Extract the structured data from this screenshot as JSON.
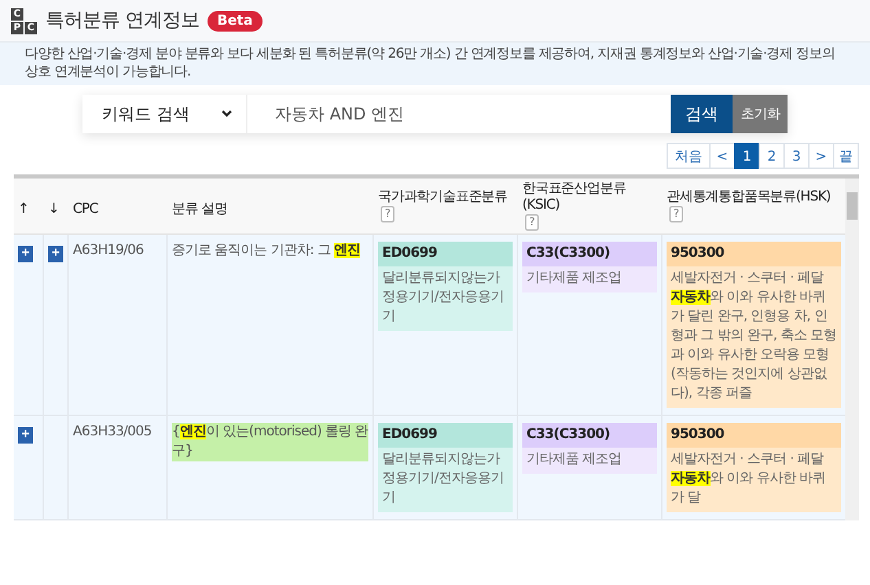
{
  "header": {
    "logo_letters": [
      "C",
      "P",
      "C"
    ],
    "title": "특허분류 연계정보",
    "badge": "Beta"
  },
  "notice": "다양한 산업·기술·경제 분야 분류와 보다 세분화 된 특허분류(약 26만 개소) 간 연계정보를 제공하여, 지재권 통계정보와 산업·기술·경제 정보의 상호 연계분석이 가능합니다.",
  "search": {
    "mode": "키워드 검색",
    "query": "자동차 AND 엔진",
    "buttons": [
      "검색",
      "초기화"
    ]
  },
  "pagination": [
    {
      "label": "처음",
      "selected": false
    },
    {
      "label": "<",
      "selected": false
    },
    {
      "label": "1",
      "selected": true
    },
    {
      "label": "2",
      "selected": false
    },
    {
      "label": "3",
      "selected": false
    },
    {
      "label": ">",
      "selected": false
    },
    {
      "label": "끝",
      "selected": false
    }
  ],
  "table": {
    "columns": [
      {
        "label": "↑"
      },
      {
        "label": "↓"
      },
      {
        "label": "CPC"
      },
      {
        "label": "분류 설명"
      },
      {
        "label": "국가과학기술표준분류",
        "help": "?"
      },
      {
        "label": "한국표준산업분류(KSIC)",
        "help": "?"
      },
      {
        "label": "관세통계통합품목분류(HSK)",
        "help": "?"
      }
    ],
    "rows": [
      {
        "up": "+",
        "down": "+",
        "cpc": "A63H19/06",
        "description": "증기로 움직이는 기관차: 그 **엔진**",
        "highlighted": false,
        "classes": [
          {
            "code": "ED0699",
            "name": "달리분류되지않는가정용기기/전자응용기기"
          },
          {
            "code": "C33(C3300)",
            "name": "기타제품 제조업"
          },
          {
            "code": "950300",
            "name": "세발자전거 · 스쿠터 · 페달 **자동차**와 이와 유사한 바퀴가 달린 완구, 인형용 차, 인형과 그 밖의 완구, 축소 모형과 이와 유사한 오락용 모형(작동하는 것인지에 상관없다), 각종 퍼즐"
          }
        ]
      },
      {
        "up": "+",
        "cpc": "A63H33/005",
        "description": "{**엔진**이 있는(motorised) 롤링 완구}",
        "highlighted": true,
        "classes": [
          {
            "code": "ED0699",
            "name": "달리분류되지않는가정용기기/전자응용기기"
          },
          {
            "code": "C33(C3300)",
            "name": "기타제품 제조업"
          },
          {
            "code": "950300",
            "name": "세발자전거 · 스쿠터 · 페달 **자동차**와 이와 유사한 바퀴가 달"
          }
        ]
      }
    ]
  }
}
